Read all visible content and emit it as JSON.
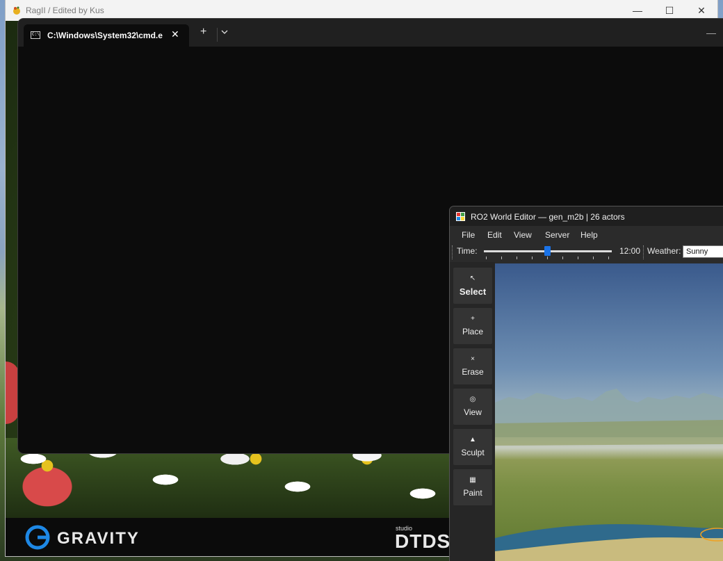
{
  "launcher": {
    "title": "RagII / Edited by Kus",
    "controls": {
      "minimize": "—",
      "maximize": "☐",
      "close": "✕"
    },
    "footer": {
      "brand_left": "GRAVITY",
      "brand_right_small": "studio",
      "brand_right": "DTDS"
    }
  },
  "terminal": {
    "tab_title": "C:\\Windows\\System32\\cmd.e",
    "tab_close": "✕",
    "new_tab": "+",
    "minimize": "—",
    "cmd_icon_text": "C:\\"
  },
  "editor": {
    "title": "RO2 World Editor — gen_m2b  |  26 actors",
    "menu": [
      "File",
      "Edit",
      "View",
      "Server",
      "Help"
    ],
    "time_label": "Time:",
    "time_value": "12:00",
    "time_position": 0.5,
    "weather_label": "Weather:",
    "weather_value": "Sunny",
    "tools": [
      {
        "glyph": "↖",
        "label": "Select",
        "active": true
      },
      {
        "glyph": "+",
        "label": "Place",
        "active": false
      },
      {
        "glyph": "×",
        "label": "Erase",
        "active": false
      },
      {
        "glyph": "◎",
        "label": "View",
        "active": false
      },
      {
        "glyph": "▲",
        "label": "Sculpt",
        "active": false
      },
      {
        "glyph": "▦",
        "label": "Paint",
        "active": false
      }
    ]
  },
  "colors": {
    "accent": "#1a73e8",
    "terminal_bg": "#0c0c0c",
    "editor_bg": "#2b2b2b"
  }
}
